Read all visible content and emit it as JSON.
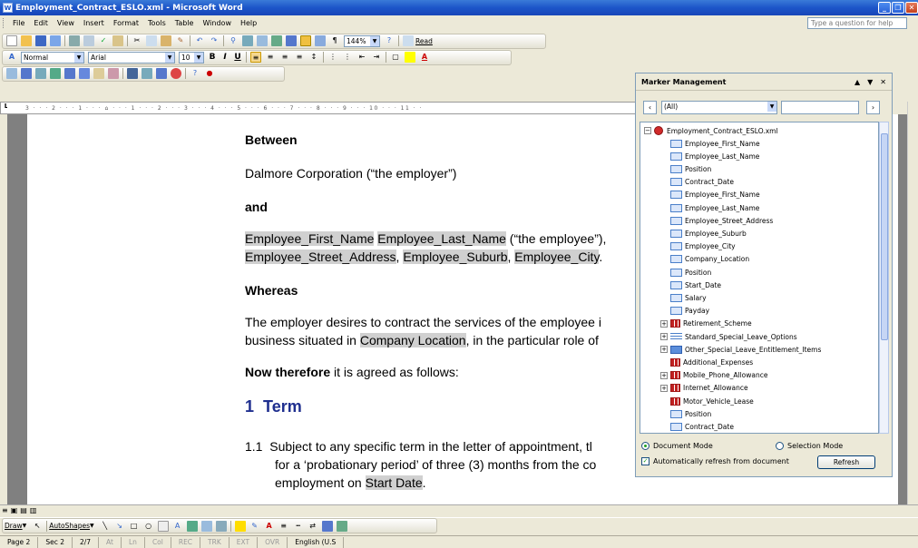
{
  "window": {
    "title": "Employment_Contract_ESLO.xml - Microsoft Word"
  },
  "menu": [
    "File",
    "Edit",
    "View",
    "Insert",
    "Format",
    "Tools",
    "Table",
    "Window",
    "Help"
  ],
  "help_placeholder": "Type a question for help",
  "toolbar": {
    "zoom": "144%",
    "read_label": "Read",
    "style": "Normal",
    "font": "Arial",
    "size": "10"
  },
  "ruler_text": "3 · · · 2 · · · 1 · · · ⌂ · · · 1 · · · 2 · · · 3 · · · 4 · · · 5 · · · 6 · · · 7 · · · 8 · · · 9 · · · 10 · · · 11 · ·",
  "document": {
    "between": "Between",
    "employer": "Dalmore Corporation (“the employer”)",
    "and": "and",
    "emp_first": "Employee_First_Name",
    "emp_last": "Employee_Last_Name",
    "emp_suffix": " (“the employee”),",
    "street": "Employee_Street_Address",
    "suburb": "Employee_Suburb",
    "city": "Employee_City",
    "whereas": "Whereas",
    "desire1": "The employer desires to contract the services of the employee i",
    "desire2a": "business situated in ",
    "company_location": "Company Location",
    "desire2b": ", in the particular role of",
    "now_bold": "Now therefore",
    "now_rest": " it is agreed as follows:",
    "h_num": "1",
    "h_title": "Term",
    "clause_num": "1.1",
    "clause1": "Subject to any specific term in the letter of appointment, tl",
    "clause2": "for a ‘probationary period’ of three (3) months from the co",
    "clause3a": "employment on ",
    "start_date": "Start Date",
    "clause3b": "."
  },
  "panel": {
    "title": "Marker Management",
    "filter": "(All)",
    "root": "Employment_Contract_ESLO.xml",
    "items": [
      {
        "label": "Employee_First_Name",
        "icon": "field-icon",
        "exp": false
      },
      {
        "label": "Employee_Last_Name",
        "icon": "field-icon",
        "exp": false
      },
      {
        "label": "Position",
        "icon": "field-icon",
        "exp": false
      },
      {
        "label": "Contract_Date",
        "icon": "field-icon",
        "exp": false
      },
      {
        "label": "Employee_First_Name",
        "icon": "field-icon",
        "exp": false
      },
      {
        "label": "Employee_Last_Name",
        "icon": "field-icon",
        "exp": false
      },
      {
        "label": "Employee_Street_Address",
        "icon": "field-icon",
        "exp": false
      },
      {
        "label": "Employee_Suburb",
        "icon": "field-icon",
        "exp": false
      },
      {
        "label": "Employee_City",
        "icon": "field-icon",
        "exp": false
      },
      {
        "label": "Company_Location",
        "icon": "field-icon",
        "exp": false
      },
      {
        "label": "Position",
        "icon": "field-icon",
        "exp": false
      },
      {
        "label": "Start_Date",
        "icon": "field-icon",
        "exp": false
      },
      {
        "label": "Salary",
        "icon": "field-icon",
        "exp": false
      },
      {
        "label": "Payday",
        "icon": "field-icon",
        "exp": false
      },
      {
        "label": "Retirement_Scheme",
        "icon": "section-icon",
        "exp": true
      },
      {
        "label": "Standard_Special_Leave_Options",
        "icon": "list-icon",
        "exp": true
      },
      {
        "label": "Other_Special_Leave_Entitlement_Items",
        "icon": "repeat-icon",
        "exp": true
      },
      {
        "label": "Additional_Expenses",
        "icon": "section-icon",
        "exp": false
      },
      {
        "label": "Mobile_Phone_Allowance",
        "icon": "section-icon",
        "exp": true
      },
      {
        "label": "Internet_Allowance",
        "icon": "section-icon",
        "exp": true
      },
      {
        "label": "Motor_Vehicle_Lease",
        "icon": "section-icon",
        "exp": false
      },
      {
        "label": "Position",
        "icon": "field-icon",
        "exp": false
      },
      {
        "label": "Contract_Date",
        "icon": "field-icon",
        "exp": false
      }
    ],
    "doc_mode": "Document Mode",
    "sel_mode": "Selection Mode",
    "auto_refresh": "Automatically refresh from document",
    "refresh": "Refresh"
  },
  "draw": {
    "draw": "Draw",
    "autoshapes": "AutoShapes"
  },
  "status": {
    "page": "Page 2",
    "sec": "Sec 2",
    "pages": "2/7",
    "at": "At",
    "ln": "Ln",
    "col": "Col",
    "rec": "REC",
    "trk": "TRK",
    "ext": "EXT",
    "ovr": "OVR",
    "lang": "English (U.S"
  }
}
